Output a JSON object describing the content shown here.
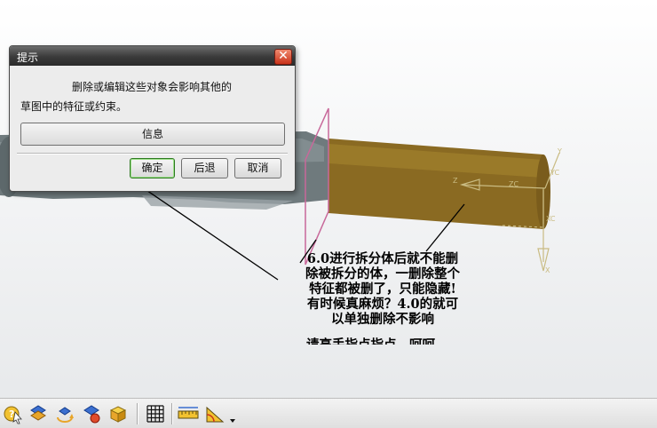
{
  "dialog": {
    "title": "提示",
    "close_glyph": "✕",
    "message_line1": "删除或编辑这些对象会影响其他的",
    "message_line2": "草图中的特征或约束。",
    "info_button": "信息",
    "ok_button": "确定",
    "back_button": "后退",
    "cancel_button": "取消"
  },
  "annotation": {
    "lines": [
      "6.0进行拆分体后就不能删",
      "除被拆分的体，一删除整个",
      "特征都被删了，只能隐藏!",
      "有时候真麻烦？4.0的就可",
      "以单独删除不影响"
    ],
    "tail": "请高手指点指点，呵呵"
  },
  "axis_labels": {
    "zc": "ZC",
    "z": "Z",
    "y": "Y",
    "yc": "YC",
    "xc": "XC",
    "x": "X"
  },
  "colors": {
    "cylinder": "#8a6a22",
    "gray_part": "#6f7a7d",
    "datum_plane": "#c8689a",
    "dialog_title": "#3a3a3a",
    "close_button": "#c9331a",
    "default_button_border": "#2d7a20"
  },
  "toolbar": {
    "icons": [
      "help-pointer-icon",
      "show-hide-icon",
      "rotate-icon",
      "display-toggle-icon",
      "shaded-cube-icon",
      "grid-icon",
      "ruler-icon",
      "angle-measure-icon",
      "dropdown-arrow-icon"
    ]
  }
}
